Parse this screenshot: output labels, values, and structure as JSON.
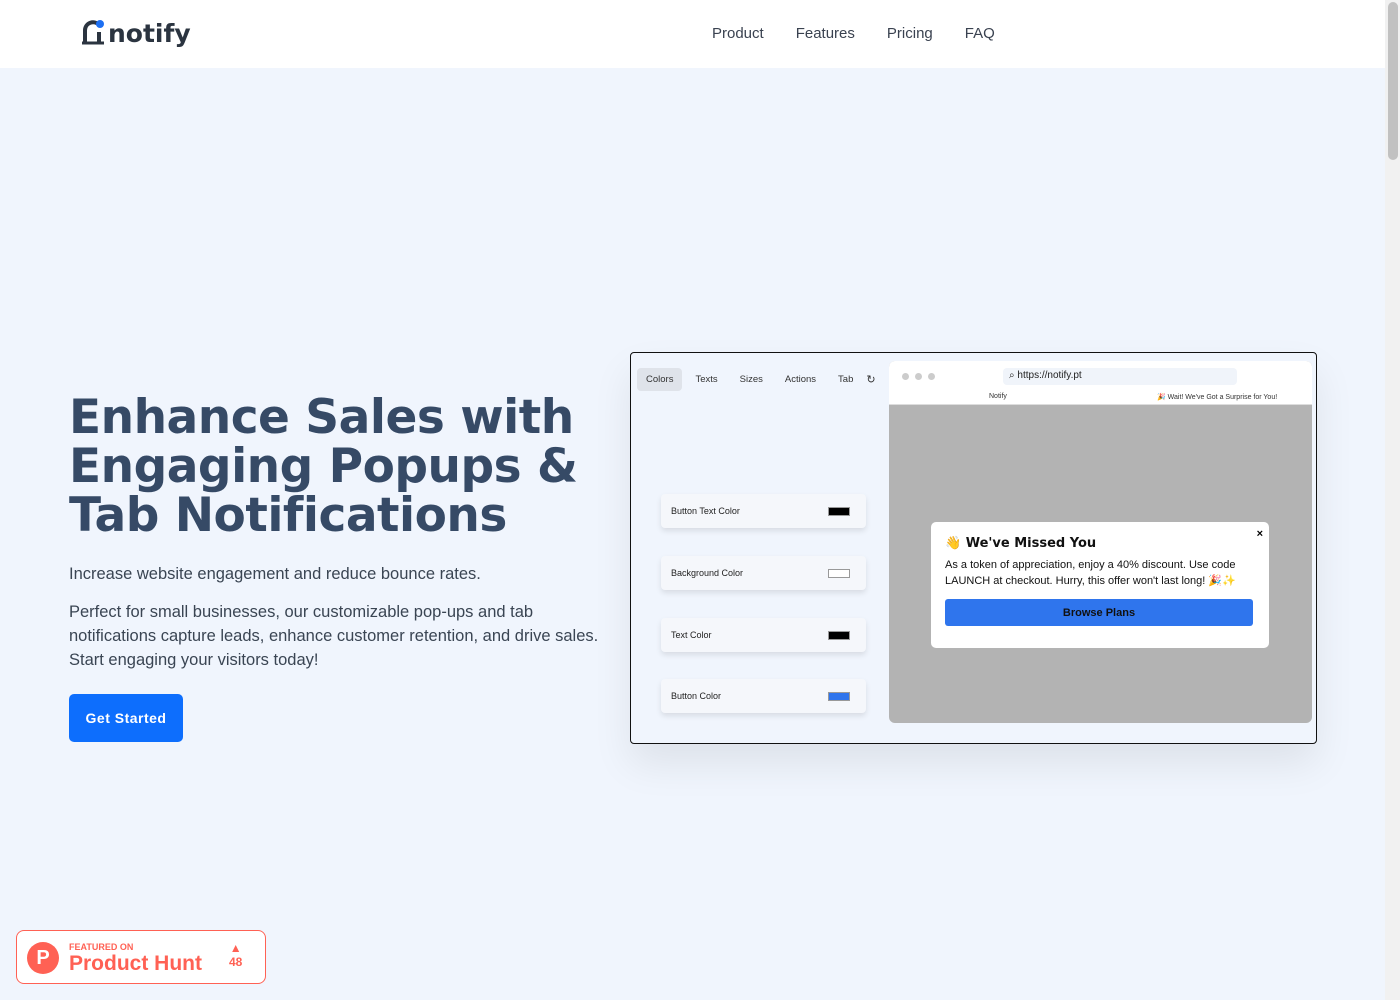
{
  "nav": {
    "logo": "notify",
    "links": [
      "Product",
      "Features",
      "Pricing",
      "FAQ"
    ]
  },
  "hero": {
    "title": "Enhance Sales with Engaging Popups & Tab Notifications",
    "subtitle": "Increase website engagement and reduce bounce rates.",
    "description": "Perfect for small businesses, our customizable pop-ups and tab notifications capture leads, enhance customer retention, and drive sales. Start engaging your visitors today!",
    "cta": "Get Started"
  },
  "demo": {
    "tabs": [
      "Colors",
      "Texts",
      "Sizes",
      "Actions",
      "Tab"
    ],
    "active_tab": "Colors",
    "settings": [
      {
        "label": "Button Text Color",
        "color": "#000000"
      },
      {
        "label": "Background Color",
        "color": "#ffffff"
      },
      {
        "label": "Text Color",
        "color": "#000000"
      },
      {
        "label": "Button Color",
        "color": "#2f75ed"
      }
    ],
    "browser": {
      "url": "https://notify.pt",
      "tab1": "Notify",
      "tab2": "🎉 Wait! We've Got a Surprise for You!"
    },
    "popup": {
      "title": "👋 We've Missed You",
      "text": "As a token of appreciation, enjoy a 40% discount. Use code LAUNCH at checkout. Hurry, this offer won't last long! 🎉✨",
      "button": "Browse Plans",
      "close": "×"
    }
  },
  "product_hunt": {
    "featured": "FEATURED ON",
    "name": "Product Hunt",
    "votes": "48",
    "logo": "P"
  }
}
